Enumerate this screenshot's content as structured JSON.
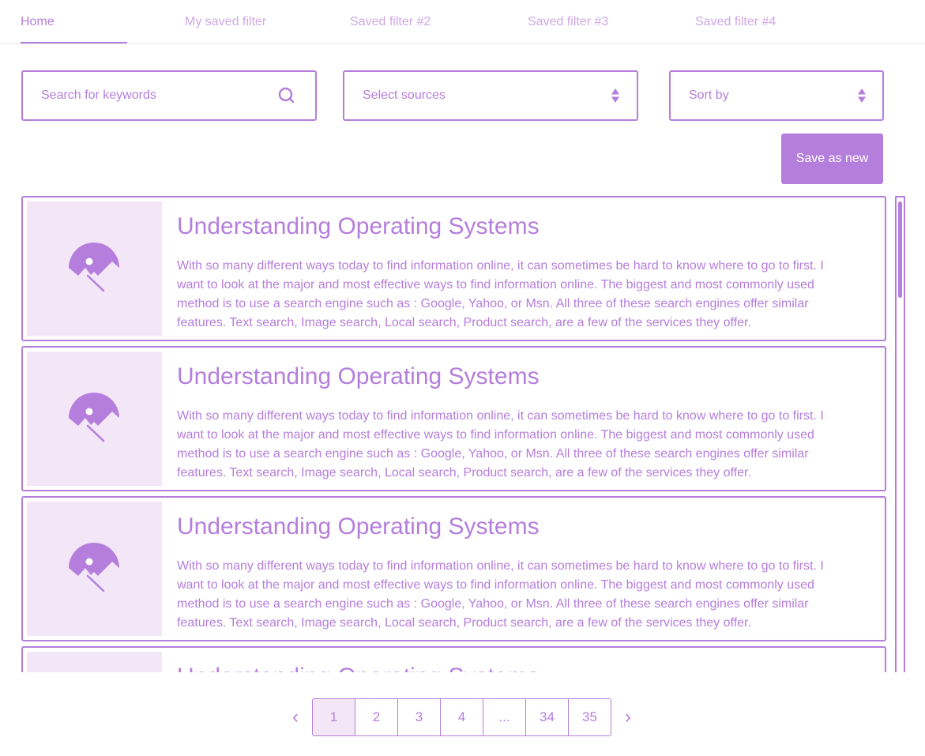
{
  "tabs": [
    {
      "label": "Home",
      "active": true
    },
    {
      "label": "My saved filter",
      "active": false
    },
    {
      "label": "Saved filter #2",
      "active": false
    },
    {
      "label": "Saved filter #3",
      "active": false
    },
    {
      "label": "Saved filter #4",
      "active": false
    }
  ],
  "filters": {
    "search_placeholder": "Search for keywords",
    "search_icon": "search-icon",
    "sources_placeholder": "Select sources",
    "sort_placeholder": "Sort by",
    "select_icon": "sort-arrows-icon"
  },
  "save_button": "Save as new",
  "articles": [
    {
      "title": "Understanding Operating Systems",
      "body": "With so many different ways today to find information online, it can sometimes be hard to know where to go to first. I want to look at the major and most effective ways to find information online.   The biggest and most commonly used method is to use a search engine such as : Google, Yahoo, or Msn. All three of these search engines offer similar features. Text search, Image search, Local search, Product search, are a few of the services they offer.",
      "image_icon": "image-placeholder-icon"
    },
    {
      "title": "Understanding Operating Systems",
      "body": "With so many different ways today to find information online, it can sometimes be hard to know where to go to first. I want to look at the major and most effective ways to find information online.   The biggest and most commonly used method is to use a search engine such as : Google, Yahoo, or Msn. All three of these search engines offer similar features. Text search, Image search, Local search, Product search, are a few of the services they offer.",
      "image_icon": "image-placeholder-icon"
    },
    {
      "title": "Understanding Operating Systems",
      "body": "With so many different ways today to find information online, it can sometimes be hard to know where to go to first. I want to look at the major and most effective ways to find information online.   The biggest and most commonly used method is to use a search engine such as : Google, Yahoo, or Msn. All three of these search engines offer similar features. Text search, Image search, Local search, Product search, are a few of the services they offer.",
      "image_icon": "image-placeholder-icon"
    },
    {
      "title": "Understanding Operating Systems",
      "body": "",
      "image_icon": "image-placeholder-icon"
    }
  ],
  "pagination": {
    "prev": "‹",
    "next": "›",
    "pages": [
      "1",
      "2",
      "3",
      "4",
      "...",
      "34",
      "35"
    ],
    "current": "1"
  },
  "colors": {
    "accent": "#b57edc",
    "accent_light": "#f3e6f7",
    "tab_inactive": "#cfa8e6"
  }
}
